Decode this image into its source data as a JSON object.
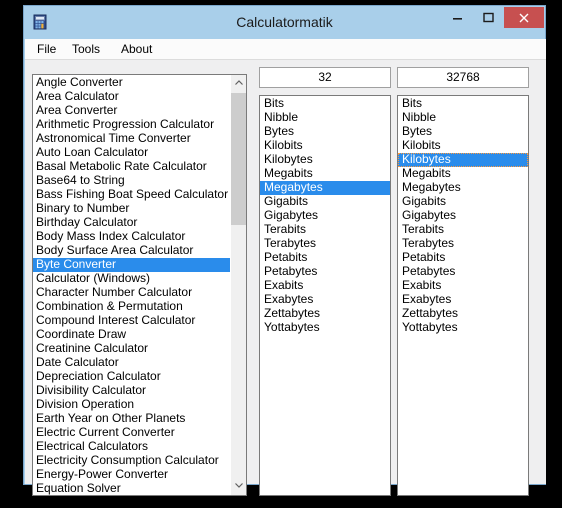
{
  "window": {
    "title": "Calculatormatik",
    "icon": "calculator-icon",
    "controls": {
      "minimize": "–",
      "maximize": "□",
      "close": "✕"
    },
    "accent_title_bar": "#a9cfea",
    "accent_close_button": "#c75050",
    "selection_color": "#2a8ceb"
  },
  "menubar": {
    "items": [
      {
        "label": "File"
      },
      {
        "label": "Tools"
      },
      {
        "label": "About"
      }
    ]
  },
  "category_list": {
    "selected": "Byte Converter",
    "items": [
      "Angle Converter",
      "Area Calculator",
      "Area Converter",
      "Arithmetic Progression Calculator",
      "Astronomical Time Converter",
      "Auto Loan Calculator",
      "Basal Metabolic Rate Calculator",
      "Base64 to String",
      "Bass Fishing Boat Speed Calculator",
      "Binary to Number",
      "Birthday Calculator",
      "Body Mass Index Calculator",
      "Body Surface Area Calculator",
      "Byte Converter",
      "Calculator (Windows)",
      "Character Number Calculator",
      "Combination & Permutation",
      "Compound Interest Calculator",
      "Coordinate Draw",
      "Creatinine Calculator",
      "Date Calculator",
      "Depreciation Calculator",
      "Divisibility Calculator",
      "Division Operation",
      "Earth Year on Other Planets",
      "Electric Current Converter",
      "Electrical Calculators",
      "Electricity Consumption Calculator",
      "Energy-Power Converter",
      "Equation Solver"
    ]
  },
  "converter": {
    "source": {
      "value": "32",
      "selected_unit": "Megabytes",
      "focused": false,
      "units": [
        "Bits",
        "Nibble",
        "Bytes",
        "Kilobits",
        "Kilobytes",
        "Megabits",
        "Megabytes",
        "Gigabits",
        "Gigabytes",
        "Terabits",
        "Terabytes",
        "Petabits",
        "Petabytes",
        "Exabits",
        "Exabytes",
        "Zettabytes",
        "Yottabytes"
      ]
    },
    "target": {
      "value": "32768",
      "selected_unit": "Kilobytes",
      "focused": true,
      "units": [
        "Bits",
        "Nibble",
        "Bytes",
        "Kilobits",
        "Kilobytes",
        "Megabits",
        "Megabytes",
        "Gigabits",
        "Gigabytes",
        "Terabits",
        "Terabytes",
        "Petabits",
        "Petabytes",
        "Exabits",
        "Exabytes",
        "Zettabytes",
        "Yottabytes"
      ]
    }
  },
  "scrollbar": {
    "up_arrow": "chevron-up-icon",
    "down_arrow": "chevron-down-icon"
  }
}
